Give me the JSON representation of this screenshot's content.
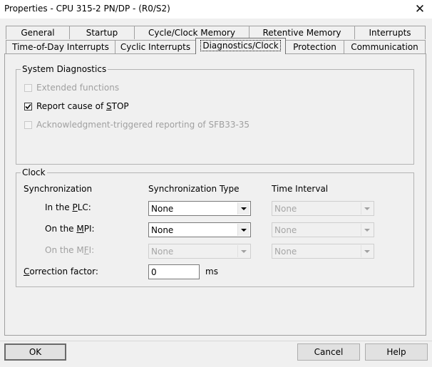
{
  "window": {
    "title": "Properties - CPU 315-2 PN/DP - (R0/S2)"
  },
  "tabs_row1": [
    {
      "label": "General"
    },
    {
      "label": "Startup"
    },
    {
      "label": "Cycle/Clock Memory"
    },
    {
      "label": "Retentive Memory"
    },
    {
      "label": "Interrupts"
    }
  ],
  "tabs_row2": [
    {
      "label": "Time-of-Day Interrupts"
    },
    {
      "label": "Cyclic Interrupts"
    },
    {
      "label": "Diagnostics/Clock",
      "active": true
    },
    {
      "label": "Protection"
    },
    {
      "label": "Communication"
    }
  ],
  "system_diagnostics": {
    "legend": "System Diagnostics",
    "extended_functions": {
      "label": "Extended functions",
      "checked": false,
      "enabled": false
    },
    "report_stop": {
      "label_pre": "Report cause of ",
      "label_key": "S",
      "label_post": "TOP",
      "checked": true,
      "enabled": true
    },
    "ack_reporting": {
      "label": "Acknowledgment-triggered reporting of SFB33-35",
      "checked": false,
      "enabled": false
    }
  },
  "clock": {
    "legend": "Clock",
    "col_sync": "Synchronization",
    "col_type": "Synchronization Type",
    "col_interval": "Time Interval",
    "rows": [
      {
        "pre": "In the ",
        "key": "P",
        "post": "LC:",
        "type": "None",
        "interval": "None",
        "enabled": true
      },
      {
        "pre": "On the ",
        "key": "M",
        "post": "PI:",
        "type": "None",
        "interval": "None",
        "enabled": true
      },
      {
        "pre": "On the M",
        "key": "F",
        "post": "I:",
        "type": "None",
        "interval": "None",
        "enabled": false
      }
    ],
    "correction_key": "C",
    "correction_rest": "orrection factor:",
    "correction_value": "0",
    "correction_unit": "ms"
  },
  "buttons": {
    "ok": "OK",
    "cancel": "Cancel",
    "help": "Help"
  }
}
